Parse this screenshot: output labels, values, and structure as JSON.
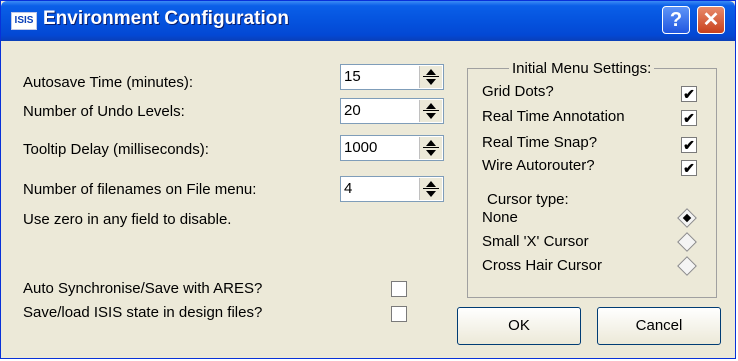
{
  "window": {
    "title": "Environment Configuration",
    "app_icon_text": "ISIS",
    "help_glyph": "?",
    "close_glyph": "✕"
  },
  "fields": [
    {
      "label": "Autosave Time (minutes):",
      "value": "15"
    },
    {
      "label": "Number of Undo Levels:",
      "value": "20"
    },
    {
      "label": "Tooltip Delay (milliseconds):",
      "value": "1000"
    },
    {
      "label": "Number of filenames on File menu:",
      "value": "4"
    }
  ],
  "hint": "Use zero in any field to disable.",
  "options": [
    {
      "label": "Auto Synchronise/Save with ARES?",
      "checked": false
    },
    {
      "label": "Save/load ISIS state in design files?",
      "checked": false
    }
  ],
  "menu_settings": {
    "title": "Initial Menu Settings:",
    "items": [
      {
        "label": "Grid Dots?",
        "checked": true
      },
      {
        "label": "Real Time Annotation",
        "checked": true
      },
      {
        "label": "Real Time Snap?",
        "checked": true
      },
      {
        "label": "Wire Autorouter?",
        "checked": true
      }
    ],
    "cursor_label": "Cursor type:",
    "cursors": [
      {
        "label": "None",
        "selected": true
      },
      {
        "label": "Small 'X' Cursor",
        "selected": false
      },
      {
        "label": "Cross Hair Cursor",
        "selected": false
      }
    ]
  },
  "buttons": {
    "ok": "OK",
    "cancel": "Cancel"
  },
  "check_glyph": "✔"
}
